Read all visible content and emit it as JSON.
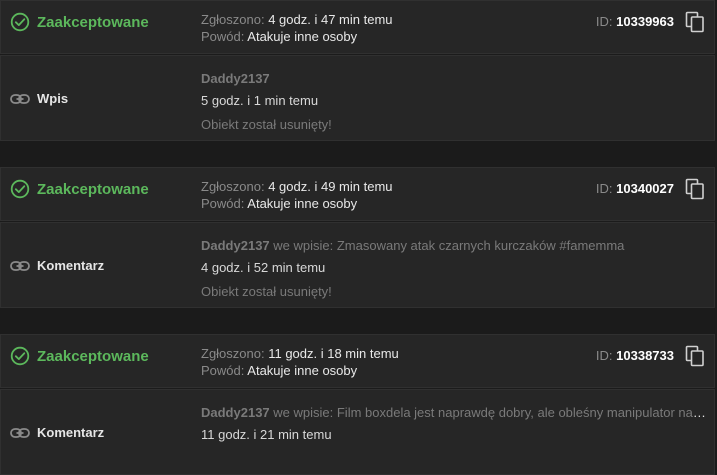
{
  "reports": [
    {
      "status": "Zaakceptowane",
      "reported_label": "Zgłoszono:",
      "reported_time": "4 godz. i 47 min temu",
      "reason_label": "Powód:",
      "reason": "Atakuje inne osoby",
      "id_label": "ID:",
      "id": "10339963",
      "kind": "Wpis",
      "author": "Daddy2137",
      "context": "",
      "time": "5 godz. i 1 min temu",
      "removed": "Obiekt został usunięty!"
    },
    {
      "status": "Zaakceptowane",
      "reported_label": "Zgłoszono:",
      "reported_time": "4 godz. i 49 min temu",
      "reason_label": "Powód:",
      "reason": "Atakuje inne osoby",
      "id_label": "ID:",
      "id": "10340027",
      "kind": "Komentarz",
      "author": "Daddy2137",
      "context": "we wpisie: Zmasowany atak czarnych kurczaków #famemma",
      "time": "4 godz. i 52 min temu",
      "removed": "Obiekt został usunięty!"
    },
    {
      "status": "Zaakceptowane",
      "reported_label": "Zgłoszono:",
      "reported_time": "11 godz. i 18 min temu",
      "reason_label": "Powód:",
      "reason": "Atakuje inne osoby",
      "id_label": "ID:",
      "id": "10338733",
      "kind": "Komentarz",
      "author": "Daddy2137",
      "context": "we wpisie: Film boxdela jest naprawdę dobry, ale obleśny manipulator napę...",
      "time": "11 godz. i 21 min temu",
      "removed": ""
    }
  ],
  "colors": {
    "accepted": "#5cb85c",
    "background": "#1b1b1b",
    "panel": "#262626"
  },
  "icons": {
    "status": "check-circle-icon",
    "kind": "link-icon",
    "copy": "copy-icon"
  }
}
